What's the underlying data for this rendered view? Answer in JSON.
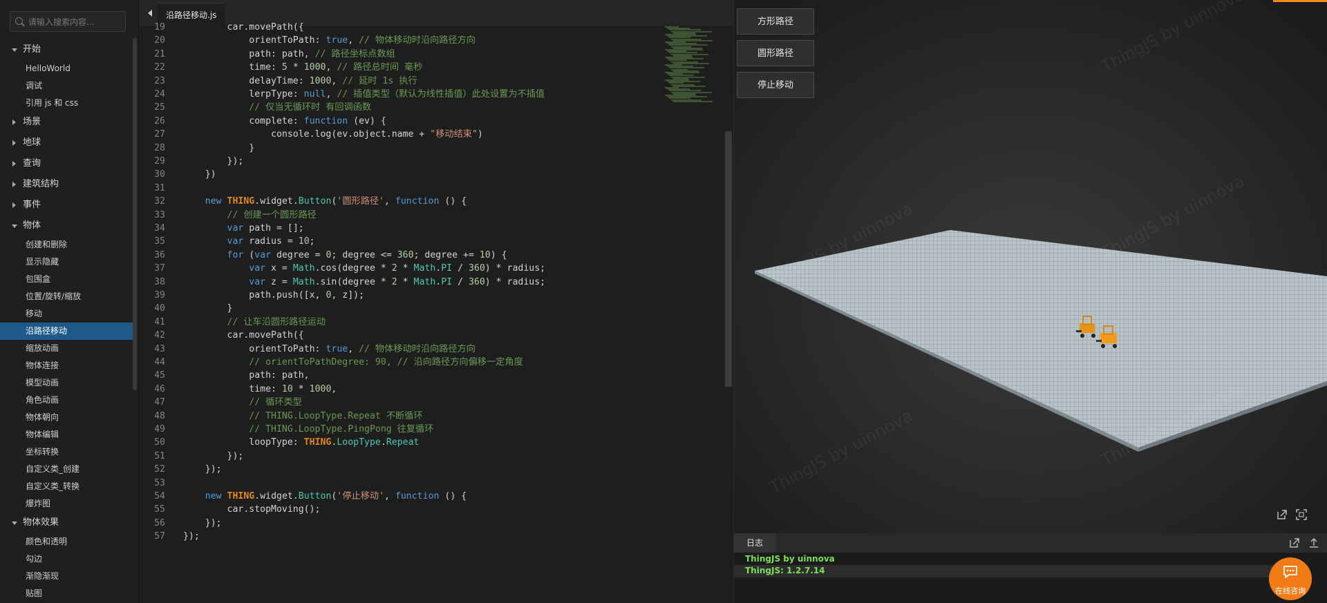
{
  "sidebar": {
    "search_placeholder": "请输入搜索内容...",
    "groups": [
      {
        "label": "开始",
        "open": true,
        "items": [
          "HelloWorld",
          "调试",
          "引用 js 和 css"
        ]
      },
      {
        "label": "场景",
        "open": false,
        "items": []
      },
      {
        "label": "地球",
        "open": false,
        "items": []
      },
      {
        "label": "查询",
        "open": false,
        "items": []
      },
      {
        "label": "建筑结构",
        "open": false,
        "items": []
      },
      {
        "label": "事件",
        "open": false,
        "items": []
      },
      {
        "label": "物体",
        "open": true,
        "items": [
          "创建和删除",
          "显示隐藏",
          "包围盒",
          "位置/旋转/缩放",
          "移动",
          "沿路径移动",
          "缩放动画",
          "物体连接",
          "模型动画",
          "角色动画",
          "物体朝向",
          "物体编辑",
          "坐标转换",
          "自定义类_创建",
          "自定义类_转换",
          "爆炸图"
        ]
      },
      {
        "label": "物体效果",
        "open": true,
        "items": [
          "颜色和透明",
          "勾边",
          "渐隐渐现",
          "贴图"
        ]
      }
    ],
    "active_item": "沿路径移动"
  },
  "editor": {
    "tab_label": "沿路径移动.js",
    "first_line_number": 19,
    "lines": [
      "        car.movePath({",
      "            orientToPath: true, // 物体移动时沿向路径方向",
      "            path: path, // 路径坐标点数组",
      "            time: 5 * 1000, // 路径总时间 毫秒",
      "            delayTime: 1000, // 延时 1s 执行",
      "            lerpType: null, // 插值类型（默认为线性插值）此处设置为不插值",
      "            // 仅当无循环时 有回调函数",
      "            complete: function (ev) {",
      "                console.log(ev.object.name + \"移动结束\")",
      "            }",
      "        });",
      "    })",
      "",
      "    new THING.widget.Button('圆形路径', function () {",
      "        // 创建一个圆形路径",
      "        var path = [];",
      "        var radius = 10;",
      "        for (var degree = 0; degree <= 360; degree += 10) {",
      "            var x = Math.cos(degree * 2 * Math.PI / 360) * radius;",
      "            var z = Math.sin(degree * 2 * Math.PI / 360) * radius;",
      "            path.push([x, 0, z]);",
      "        }",
      "        // 让车沿圆形路径运动",
      "        car.movePath({",
      "            orientToPath: true, // 物体移动时沿向路径方向",
      "            // orientToPathDegree: 90, // 沿向路径方向偏移一定角度",
      "            path: path,",
      "            time: 10 * 1000,",
      "            // 循环类型",
      "            // THING.LoopType.Repeat 不断循环",
      "            // THING.LoopType.PingPong 往复循环",
      "            loopType: THING.LoopType.Repeat",
      "        });",
      "    });",
      "",
      "    new THING.widget.Button('停止移动', function () {",
      "        car.stopMoving();",
      "    });",
      "});"
    ]
  },
  "preview": {
    "buttons": [
      "方形路径",
      "圆形路径",
      "停止移动"
    ],
    "watermark": "ThingJS by uinnova"
  },
  "log": {
    "tab_label": "日志",
    "lines": [
      "ThingJS by uinnova",
      "ThingJS: 1.2.7.14"
    ]
  },
  "chat": {
    "label": "在线咨询"
  },
  "colors": {
    "accent": "#f07b17",
    "active_nav": "#1e5b8c",
    "log_text": "#7dde5a"
  }
}
